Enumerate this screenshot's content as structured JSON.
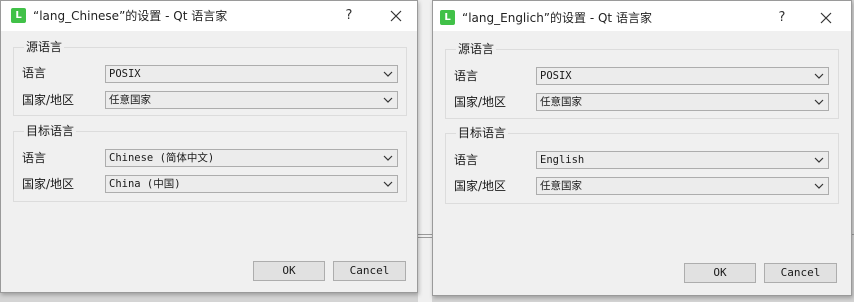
{
  "dialogs": [
    {
      "app_icon_letter": "L",
      "title": "“lang_Chinese”的设置 - Qt 语言家",
      "help_label": "?",
      "source_group": {
        "title": "源语言",
        "language_label": "语言",
        "language_value": "POSIX",
        "country_label": "国家/地区",
        "country_value": "任意国家"
      },
      "target_group": {
        "title": "目标语言",
        "language_label": "语言",
        "language_value": "Chinese (简体中文)",
        "country_label": "国家/地区",
        "country_value": "China (中国)"
      },
      "ok_label": "OK",
      "cancel_label": "Cancel"
    },
    {
      "app_icon_letter": "L",
      "title": "“lang_Englich”的设置 - Qt 语言家",
      "help_label": "?",
      "source_group": {
        "title": "源语言",
        "language_label": "语言",
        "language_value": "POSIX",
        "country_label": "国家/地区",
        "country_value": "任意国家"
      },
      "target_group": {
        "title": "目标语言",
        "language_label": "语言",
        "language_value": "English",
        "country_label": "国家/地区",
        "country_value": "任意国家"
      },
      "ok_label": "OK",
      "cancel_label": "Cancel"
    }
  ]
}
